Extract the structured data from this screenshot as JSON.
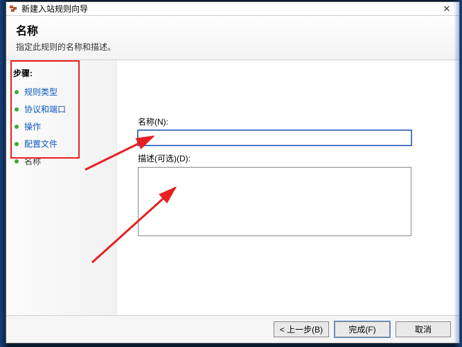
{
  "window": {
    "title": "新建入站规则向导"
  },
  "header": {
    "title": "名称",
    "subtitle": "指定此规则的名称和描述。"
  },
  "sidebar": {
    "title": "步骤:",
    "items": [
      {
        "label": "规则类型",
        "link": true
      },
      {
        "label": "协议和端口",
        "link": true
      },
      {
        "label": "操作",
        "link": true
      },
      {
        "label": "配置文件",
        "link": true
      },
      {
        "label": "名称",
        "link": false
      }
    ]
  },
  "form": {
    "name_label": "名称(N):",
    "name_value": "",
    "desc_label": "描述(可选)(D):",
    "desc_value": ""
  },
  "footer": {
    "back": "< 上一步(B)",
    "finish": "完成(F)",
    "cancel": "取消"
  }
}
